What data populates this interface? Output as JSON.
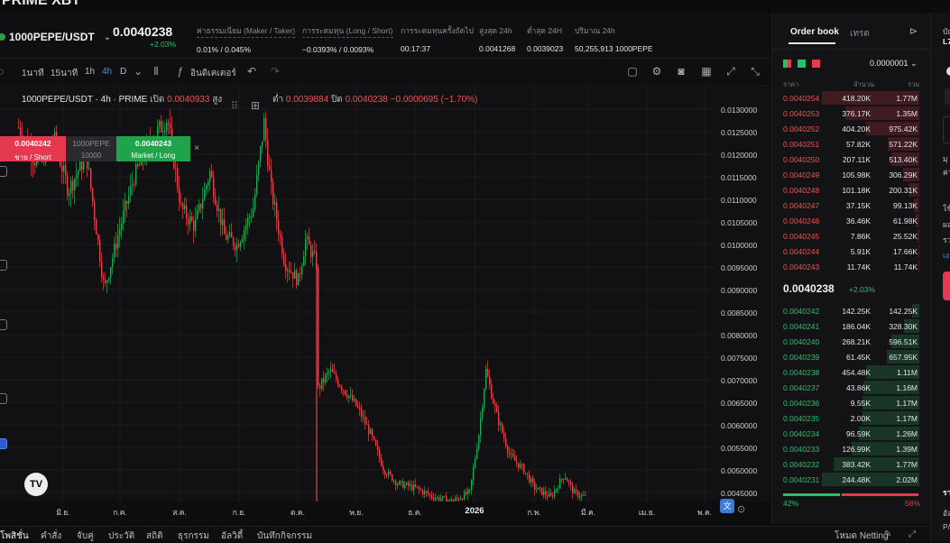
{
  "window": {
    "title": "PRIME XBT"
  },
  "ticker": {
    "pair": "1000PEPE/USDT",
    "last_price": "0.0040238",
    "change_pct": "+2.03%",
    "stats": [
      {
        "label": "ค่าธรรมเนียม (Maker / Taker)",
        "value": "0.01% / 0.045%"
      },
      {
        "label": "การระดมทุน (Long / Short)",
        "value": "−0.0393% / 0.0093%"
      },
      {
        "label": "การระดมทุนครั้งถัดไป",
        "value": "00:17:37"
      },
      {
        "label": "สูงสุด 24h",
        "value": "0.0041268"
      },
      {
        "label": "ต่ำสุด 24H",
        "value": "0.0039023"
      },
      {
        "label": "ปริมาณ 24h",
        "value": "50,255,913 1000PEPE"
      }
    ]
  },
  "toolbar": {
    "intervals": [
      "1นาที",
      "15นาที",
      "1h",
      "4h",
      "D"
    ],
    "active_interval": "4h",
    "indicators_label": "อินดิเคเตอร์"
  },
  "chart": {
    "legend": {
      "symbol": "1000PEPE/USDT · 4h · PRIME",
      "open_label": "เปิด",
      "open": "0.0040933",
      "high_label": "สูง",
      "low_label": "ต่ำ",
      "low": "0.0039884",
      "close_label": "ปิด",
      "close": "0.0040238",
      "change": "−0.0000695 (−1.70%)"
    },
    "quick_trade": {
      "sell_price": "0.0040242",
      "sell_label": "ขาย / Short",
      "qty_asset": "1000PEPE",
      "qty": "10000",
      "buy_price": "0.0040243",
      "buy_label": "Market / Long"
    },
    "logo_text": "TV",
    "y_labels": [
      "0.0130000",
      "0.0125000",
      "0.0120000",
      "0.0115000",
      "0.0110000",
      "0.0105000",
      "0.0100000",
      "0.0095000",
      "0.0090000",
      "0.0085000",
      "0.0080000",
      "0.0075000",
      "0.0070000",
      "0.0065000",
      "0.0060000",
      "0.0055000",
      "0.0050000",
      "0.0045000"
    ],
    "x_labels": [
      "มิ.ย.",
      "ก.ค.",
      "ส.ค.",
      "ก.ย.",
      "ต.ค.",
      "พ.ย.",
      "ธ.ค.",
      "2026",
      "ก.พ.",
      "มี.ค.",
      "เม.ย.",
      "พ.ค."
    ],
    "up_color": "#26a65b",
    "down_color": "#e04552"
  },
  "chart_data": {
    "type": "candlestick",
    "ylim": [
      0.0044,
      0.0132
    ],
    "x": [
      "มิ.ย.",
      "ก.ค.",
      "ส.ค.",
      "ก.ย.",
      "ต.ค.",
      "พ.ย.",
      "ธ.ค.",
      "2026",
      "ก.พ.",
      "มี.ค."
    ],
    "close": [
      0.0113,
      0.0103,
      0.0121,
      0.011,
      0.0098,
      0.0066,
      0.0049,
      0.0062,
      0.0049,
      0.0044
    ],
    "last": 0.0040238
  },
  "bottom_tabs": [
    "โพสิชั่น",
    "คำสั่ง",
    "จับคู่",
    "ประวัติ",
    "สถิติ",
    "ธุรกรรม",
    "อัลวิดี้",
    "บันทึกกิจกรรม"
  ],
  "bottom_right": "โหมด Netting",
  "orderbook": {
    "tabs": [
      "Order book",
      "เทรด"
    ],
    "tick": "0.0000001",
    "headers": [
      "ราคา",
      "จำนวน",
      "รวม"
    ],
    "asks": [
      {
        "price": "0.0040254",
        "amount": "418.20K",
        "total": "1.77M",
        "depth": 1.0
      },
      {
        "price": "0.0040253",
        "amount": "376.17K",
        "total": "1.35M",
        "depth": 0.76
      },
      {
        "price": "0.0040252",
        "amount": "404.20K",
        "total": "975.42K",
        "depth": 0.55
      },
      {
        "price": "0.0040251",
        "amount": "57.82K",
        "total": "571.22K",
        "depth": 0.32
      },
      {
        "price": "0.0040250",
        "amount": "207.11K",
        "total": "513.40K",
        "depth": 0.29
      },
      {
        "price": "0.0040249",
        "amount": "105.98K",
        "total": "306.29K",
        "depth": 0.17
      },
      {
        "price": "0.0040248",
        "amount": "101.18K",
        "total": "200.31K",
        "depth": 0.11
      },
      {
        "price": "0.0040247",
        "amount": "37.15K",
        "total": "99.13K",
        "depth": 0.06
      },
      {
        "price": "0.0040246",
        "amount": "36.46K",
        "total": "61.98K",
        "depth": 0.035
      },
      {
        "price": "0.0040245",
        "amount": "7.86K",
        "total": "25.52K",
        "depth": 0.015
      },
      {
        "price": "0.0040244",
        "amount": "5.91K",
        "total": "17.66K",
        "depth": 0.01
      },
      {
        "price": "0.0040243",
        "amount": "11.74K",
        "total": "11.74K",
        "depth": 0.007
      }
    ],
    "mid_price": "0.0040238",
    "mid_change": "+2.03%",
    "bids": [
      {
        "price": "0.0040242",
        "amount": "142.25K",
        "total": "142.25K",
        "depth": 0.07
      },
      {
        "price": "0.0040241",
        "amount": "186.04K",
        "total": "328.30K",
        "depth": 0.16
      },
      {
        "price": "0.0040240",
        "amount": "268.21K",
        "total": "596.51K",
        "depth": 0.29
      },
      {
        "price": "0.0040239",
        "amount": "61.45K",
        "total": "657.95K",
        "depth": 0.33
      },
      {
        "price": "0.0040238",
        "amount": "454.48K",
        "total": "1.11M",
        "depth": 0.55
      },
      {
        "price": "0.0040237",
        "amount": "43.86K",
        "total": "1.16M",
        "depth": 0.57
      },
      {
        "price": "0.0040236",
        "amount": "9.55K",
        "total": "1.17M",
        "depth": 0.58
      },
      {
        "price": "0.0040235",
        "amount": "2.00K",
        "total": "1.17M",
        "depth": 0.58
      },
      {
        "price": "0.0040234",
        "amount": "96.59K",
        "total": "1.26M",
        "depth": 0.62
      },
      {
        "price": "0.0040233",
        "amount": "126.99K",
        "total": "1.39M",
        "depth": 0.69
      },
      {
        "price": "0.0040232",
        "amount": "383.42K",
        "total": "1.77M",
        "depth": 0.88
      },
      {
        "price": "0.0040231",
        "amount": "244.48K",
        "total": "2.02M",
        "depth": 1.0
      }
    ],
    "buy_ratio": "42%",
    "sell_ratio": "58%",
    "buy_ratio_value": 0.42,
    "ask_color": "#ef5350",
    "bid_color": "#2ebd6b"
  },
  "right_panel": {
    "labels": [
      "บัญ",
      "L7",
      "มุ",
      "ค่า",
      "ใช้",
      "ผล",
      "รว",
      "เง",
      "ราค",
      "อัล",
      "P/",
      "P/"
    ]
  }
}
